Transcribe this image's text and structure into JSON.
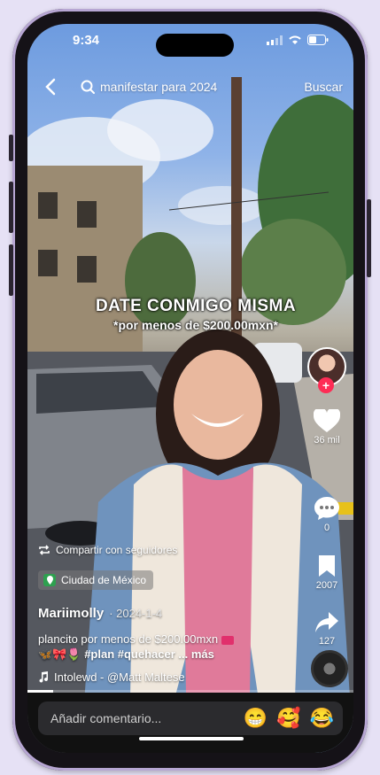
{
  "status_bar": {
    "time": "9:34"
  },
  "search": {
    "query": "manifestar para 2024",
    "submit_label": "Buscar"
  },
  "video": {
    "caption_line1": "DATE CONMIGO MISMA",
    "caption_line2": "*por menos de $200.00mxn*"
  },
  "actions": {
    "likes": "36 mil",
    "comments": "0",
    "saves": "2007",
    "shares": "127"
  },
  "post": {
    "share_with_followers": "Compartir con seguidores",
    "location": "Ciudad de México",
    "username": "Mariimolly",
    "date": "· 2024-1-4",
    "description_line1": "plancito por menos de $200.00mxn",
    "description_tags": "#plan #quehacer",
    "more": "... más",
    "sound": "Intolewd - @Matt Maltese"
  },
  "progress": 0.08,
  "comment_bar": {
    "placeholder": "Añadir comentario..."
  },
  "colors": {
    "accent": "#fe2c55",
    "location_green": "#2ea04f",
    "frame": "#b7a6d3"
  },
  "icons": [
    "back-icon",
    "search-icon",
    "heart-icon",
    "comment-icon",
    "bookmark-icon",
    "share-icon",
    "repost-icon",
    "location-icon",
    "music-note-icon"
  ]
}
